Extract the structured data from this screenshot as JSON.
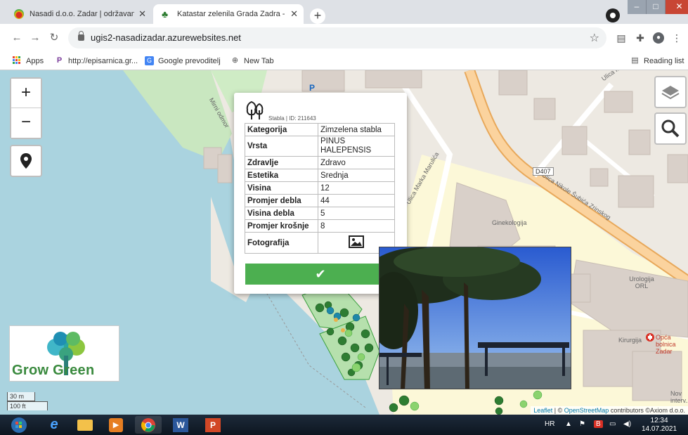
{
  "browser": {
    "tabs": [
      {
        "title": "Nasadi d.o.o. Zadar | održavanje",
        "active": false
      },
      {
        "title": "Katastar zelenila Grada Zadra - G",
        "active": true
      }
    ],
    "new_tab_label": "+",
    "url": "ugis2-nasadizadar.azurewebsites.net",
    "bookmarks": [
      {
        "label": "Apps",
        "icon": "apps-grid-icon"
      },
      {
        "label": "http://episarnica.gr...",
        "icon": "p-icon"
      },
      {
        "label": "Google prevoditelj",
        "icon": "translate-icon"
      },
      {
        "label": "New Tab",
        "icon": "globe-icon"
      }
    ],
    "reading_list": "Reading list"
  },
  "map": {
    "zoom_in": "+",
    "zoom_out": "−",
    "labels": {
      "street1": "Ulica kralja S...",
      "street2": "Ulica Nikole Šubića Zrinskog",
      "street3": "Ulica Marka Marulića",
      "street4": "Mirni odmor",
      "road_badge": "D407",
      "ginek": "Ginekologija",
      "urolog": "Urologija ORL",
      "kirurgija": "Kirurgija",
      "bolnica": "Opća bolnica Zadar",
      "parking": "P",
      "nova": "Nov interv..."
    },
    "scale_m": "30 m",
    "scale_ft": "100 ft",
    "attribution_leaflet": "Leaflet",
    "attribution_osm": "OpenStreetMap",
    "attribution_rest": "contributors ©Axiom d.o.o."
  },
  "logo": {
    "text": "Grow Green"
  },
  "popup": {
    "id_text": "Stabla | ID: 211643",
    "rows": [
      {
        "k": "Kategorija",
        "v": "Zimzelena stabla"
      },
      {
        "k": "Vrsta",
        "v": "PINUS HALEPENSIS"
      },
      {
        "k": "Zdravlje",
        "v": "Zdravo"
      },
      {
        "k": "Estetika",
        "v": "Srednja"
      },
      {
        "k": "Visina",
        "v": "12"
      },
      {
        "k": "Promjer debla",
        "v": "44"
      },
      {
        "k": "Visina debla",
        "v": "5"
      },
      {
        "k": "Promjer krošnje",
        "v": "8"
      },
      {
        "k": "Fotografija",
        "v": ""
      }
    ],
    "ok_label": "✔"
  },
  "taskbar": {
    "lang": "HR",
    "time": "12:34",
    "date": "14.07.2021"
  }
}
